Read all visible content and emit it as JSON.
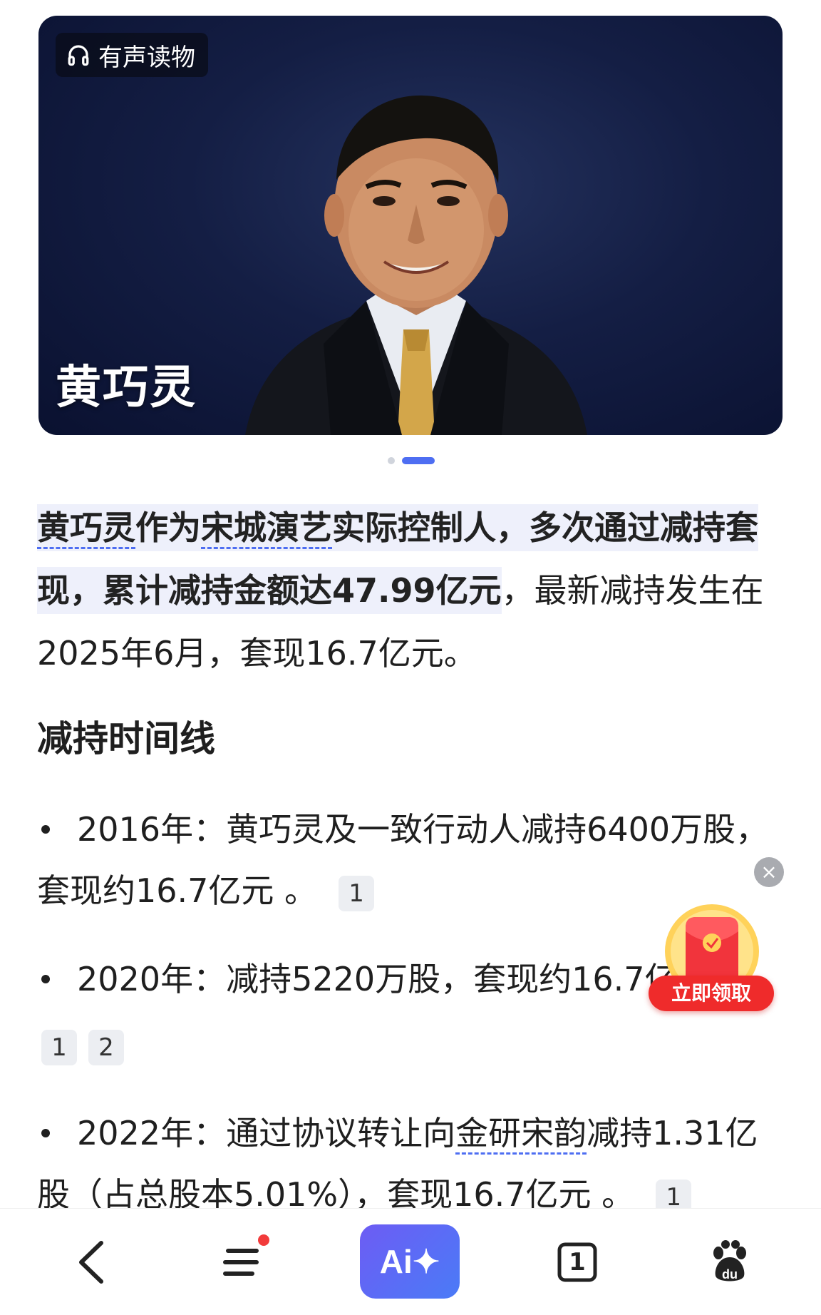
{
  "hero": {
    "badge_label": "有声读物",
    "name": "黄巧灵"
  },
  "summary": {
    "part1": "黄巧灵",
    "part2": "作为",
    "part3": "宋城演艺",
    "part4": "实际控制人，多次通过减持套现，累计减持金额达47.99亿元",
    "part5": "，最新减持发生在2025年6月，套现16.7亿元。"
  },
  "section_title": "减持时间线",
  "timeline": [
    {
      "text": "2016年：黄巧灵及一致行动人减持6400万股，套现约16.7亿元 。",
      "cites": [
        "1"
      ]
    },
    {
      "text": "2020年：减持5220万股，套现约16.7亿",
      "cites": [
        "1",
        "2"
      ]
    },
    {
      "text_a": "2022年：通过协议转让向",
      "link": "金研宋韵",
      "text_b": "减持1.31亿股（占总股本5.01%），套现16.7亿元 。",
      "cites": [
        "1"
      ]
    }
  ],
  "floating": {
    "close": "×",
    "label": "立即领取"
  },
  "nav": {
    "ai_label": "Ai✦",
    "tabs_count": "1"
  },
  "colors": {
    "accent": "#4e6ef2",
    "highlight_bg": "#eef0fb",
    "red": "#ef2b2b"
  }
}
